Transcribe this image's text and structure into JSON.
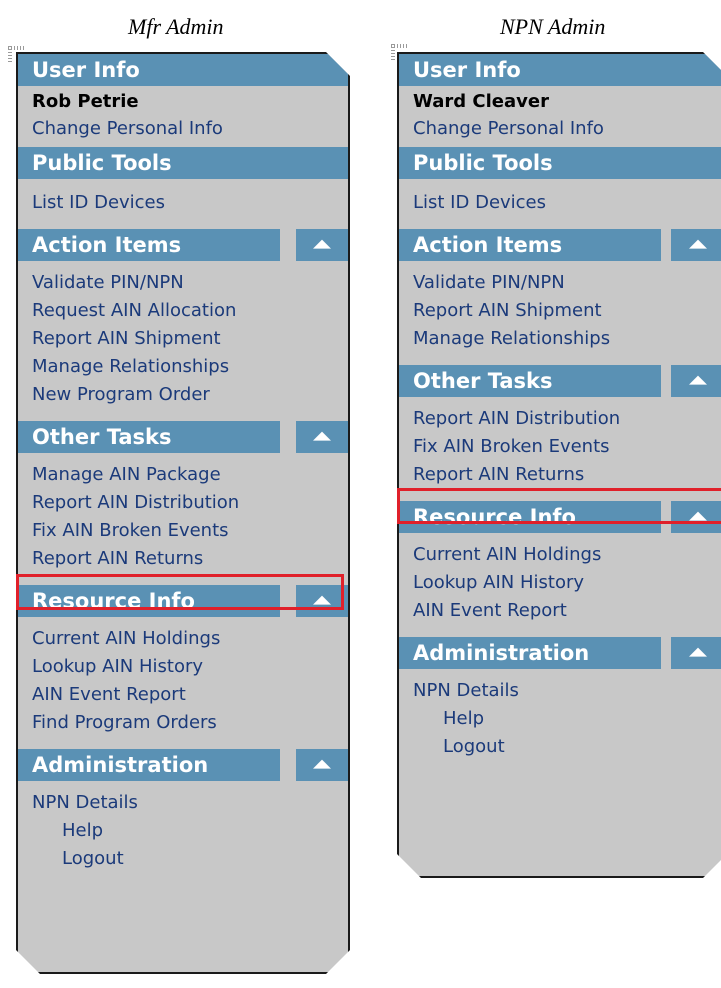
{
  "captions": {
    "left": "Mfr Admin",
    "right": "NPN Admin"
  },
  "icons": {
    "collapse": "chevron-up-icon"
  },
  "colors": {
    "header_bg": "#5a91b4",
    "panel_bg": "#c8c8c8",
    "link": "#1b3a7a",
    "highlight": "#e0202a"
  },
  "left": {
    "user_info": {
      "title": "User Info",
      "name": "Rob Petrie",
      "link": "Change Personal Info"
    },
    "public_tools": {
      "title": "Public Tools",
      "items": [
        "List ID Devices"
      ]
    },
    "action_items": {
      "title": "Action Items",
      "items": [
        "Validate PIN/NPN",
        "Request AIN Allocation",
        "Report AIN Shipment",
        "Manage Relationships",
        "New Program Order"
      ]
    },
    "other_tasks": {
      "title": "Other Tasks",
      "items": [
        "Manage AIN Package",
        "Report AIN Distribution",
        "Fix AIN Broken Events",
        "Report AIN Returns"
      ]
    },
    "resource_info": {
      "title": "Resource Info",
      "items": [
        "Current AIN Holdings",
        "Lookup AIN History",
        "AIN Event Report",
        "Find Program Orders"
      ]
    },
    "administration": {
      "title": "Administration",
      "items": [
        "NPN Details",
        "Help",
        "Logout"
      ]
    }
  },
  "right": {
    "user_info": {
      "title": "User Info",
      "name": "Ward Cleaver",
      "link": "Change Personal Info"
    },
    "public_tools": {
      "title": "Public Tools",
      "items": [
        "List ID Devices"
      ]
    },
    "action_items": {
      "title": "Action Items",
      "items": [
        "Validate PIN/NPN",
        "Report AIN Shipment",
        "Manage Relationships"
      ]
    },
    "other_tasks": {
      "title": "Other Tasks",
      "items": [
        "Report AIN Distribution",
        "Fix AIN Broken Events",
        "Report AIN Returns"
      ]
    },
    "resource_info": {
      "title": "Resource Info",
      "items": [
        "Current AIN Holdings",
        "Lookup AIN History",
        "AIN Event Report"
      ]
    },
    "administration": {
      "title": "Administration",
      "items": [
        "NPN Details",
        "Help",
        "Logout"
      ]
    }
  }
}
